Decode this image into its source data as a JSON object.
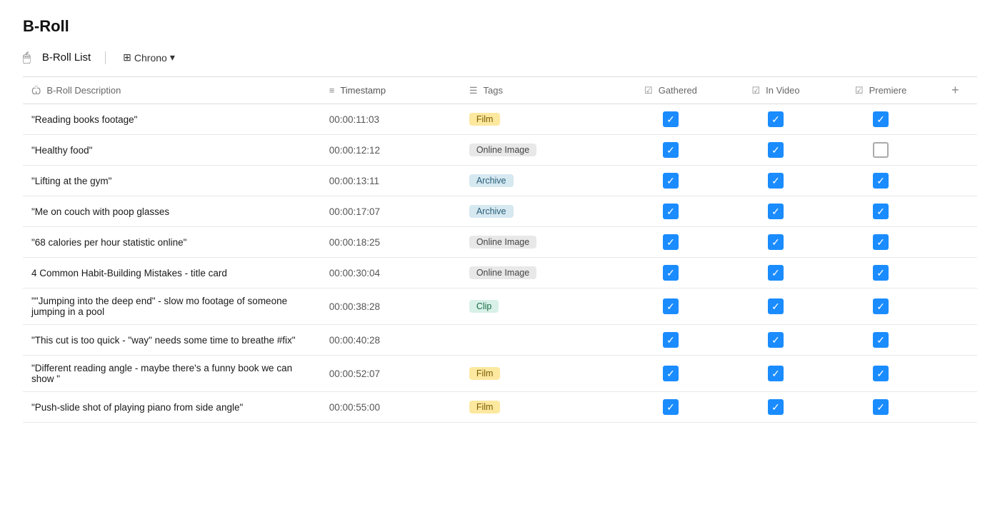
{
  "page": {
    "title": "B-Roll",
    "list_label": "B-Roll List",
    "list_icon": "🖱",
    "view_label": "Chrono",
    "view_icon": "⊞"
  },
  "columns": [
    {
      "id": "desc",
      "label": "B-Roll Description",
      "icon": "text"
    },
    {
      "id": "ts",
      "label": "Timestamp",
      "icon": "list"
    },
    {
      "id": "tags",
      "label": "Tags",
      "icon": "tag"
    },
    {
      "id": "gathered",
      "label": "Gathered",
      "icon": "check"
    },
    {
      "id": "invideo",
      "label": "In Video",
      "icon": "check"
    },
    {
      "id": "premiere",
      "label": "Premiere",
      "icon": "check"
    }
  ],
  "rows": [
    {
      "desc": "\"Reading books footage\"",
      "ts": "00:00:11:03",
      "tag": "Film",
      "tag_type": "film",
      "gathered": true,
      "invideo": true,
      "premiere": true
    },
    {
      "desc": "\"Healthy food\"",
      "ts": "00:00:12:12",
      "tag": "Online Image",
      "tag_type": "online",
      "gathered": true,
      "invideo": true,
      "premiere": false
    },
    {
      "desc": "\"Lifting at the gym\"",
      "ts": "00:00:13:11",
      "tag": "Archive",
      "tag_type": "archive",
      "gathered": true,
      "invideo": true,
      "premiere": true
    },
    {
      "desc": "\"Me on couch with poop glasses",
      "ts": "00:00:17:07",
      "tag": "Archive",
      "tag_type": "archive",
      "gathered": true,
      "invideo": true,
      "premiere": true
    },
    {
      "desc": "\"68 calories per hour statistic online\"",
      "ts": "00:00:18:25",
      "tag": "Online Image",
      "tag_type": "online",
      "gathered": true,
      "invideo": true,
      "premiere": true
    },
    {
      "desc": "4 Common Habit-Building Mistakes - title card",
      "ts": "00:00:30:04",
      "tag": "Online Image",
      "tag_type": "online",
      "gathered": true,
      "invideo": true,
      "premiere": true
    },
    {
      "desc": "\"\"Jumping into the deep end\" - slow mo footage of someone jumping in a pool",
      "ts": "00:00:38:28",
      "tag": "Clip",
      "tag_type": "clip",
      "gathered": true,
      "invideo": true,
      "premiere": true
    },
    {
      "desc": "\"This cut is too quick - \"way\" needs some time to breathe #fix\"",
      "ts": "00:00:40:28",
      "tag": "",
      "tag_type": "",
      "gathered": true,
      "invideo": true,
      "premiere": true
    },
    {
      "desc": "\"Different reading angle - maybe there's a funny book we can show \"",
      "ts": "00:00:52:07",
      "tag": "Film",
      "tag_type": "film",
      "gathered": true,
      "invideo": true,
      "premiere": true
    },
    {
      "desc": "\"Push-slide shot of playing piano from side angle\"",
      "ts": "00:00:55:00",
      "tag": "Film",
      "tag_type": "film",
      "gathered": true,
      "invideo": true,
      "premiere": true
    }
  ],
  "tag_types": {
    "film": "Film",
    "online": "Online Image",
    "archive": "Archive",
    "clip": "Clip"
  }
}
